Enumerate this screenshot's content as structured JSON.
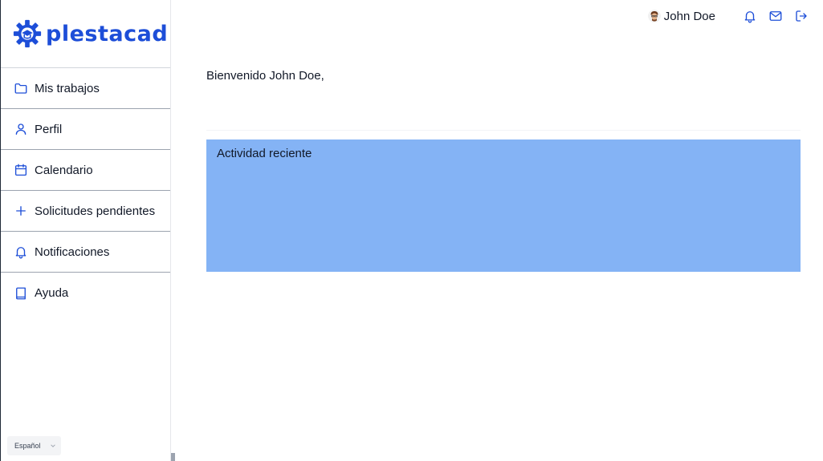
{
  "brand": {
    "name": "plestacad",
    "color": "#1d4ed8"
  },
  "sidebar": {
    "items": [
      {
        "label": "Mis trabajos",
        "icon": "folder-icon"
      },
      {
        "label": "Perfil",
        "icon": "user-icon"
      },
      {
        "label": "Calendario",
        "icon": "calendar-icon"
      },
      {
        "label": "Solicitudes pendientes",
        "icon": "plus-icon"
      },
      {
        "label": "Notificaciones",
        "icon": "bell-icon"
      },
      {
        "label": "Ayuda",
        "icon": "book-icon"
      }
    ],
    "language": "Español"
  },
  "header": {
    "user_name": "John Doe",
    "icons": [
      "bell-icon",
      "mail-icon",
      "logout-icon"
    ]
  },
  "main": {
    "welcome": "Bienvenido John Doe,",
    "activity_title": "Actividad reciente",
    "activity_color": "#84b3f5"
  }
}
